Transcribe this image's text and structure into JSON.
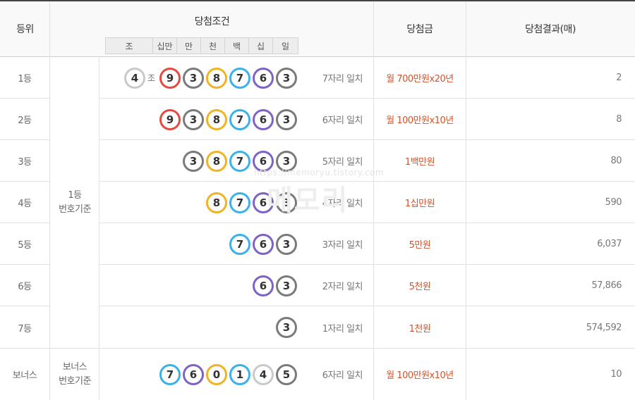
{
  "header": {
    "rank": "등위",
    "condition": "당첨조건",
    "prize": "당첨금",
    "result": "당첨결과(매)",
    "digits": [
      "조",
      "십만",
      "만",
      "천",
      "백",
      "십",
      "일"
    ]
  },
  "rows": [
    {
      "rank": "1등",
      "jo": "4",
      "jo_label": "조",
      "balls": [
        "9",
        "3",
        "8",
        "7",
        "6",
        "3"
      ],
      "match": "7자리 일치",
      "prize": "월 700만원x20년",
      "count": "2"
    },
    {
      "rank": "2등",
      "balls": [
        "9",
        "3",
        "8",
        "7",
        "6",
        "3"
      ],
      "match": "6자리 일치",
      "prize": "월 100만원x10년",
      "count": "8"
    },
    {
      "rank": "3등",
      "balls": [
        "3",
        "8",
        "7",
        "6",
        "3"
      ],
      "match": "5자리 일치",
      "prize": "1백만원",
      "count": "80"
    },
    {
      "rank": "4등",
      "balls": [
        "8",
        "7",
        "6",
        "3"
      ],
      "match": "4자리 일치",
      "prize": "1십만원",
      "count": "590"
    },
    {
      "rank": "5등",
      "balls": [
        "7",
        "6",
        "3"
      ],
      "match": "3자리 일치",
      "prize": "5만원",
      "count": "6,037"
    },
    {
      "rank": "6등",
      "balls": [
        "6",
        "3"
      ],
      "match": "2자리 일치",
      "prize": "5천원",
      "count": "57,866"
    },
    {
      "rank": "7등",
      "balls": [
        "3"
      ],
      "match": "1자리 일치",
      "prize": "1천원",
      "count": "574,592"
    },
    {
      "rank": "보너스",
      "balls": [
        "7",
        "6",
        "0",
        "1",
        "4",
        "5"
      ],
      "match": "6자리 일치",
      "prize": "월 100만원x10년",
      "count": "10"
    }
  ],
  "basis": {
    "main_line1": "1등",
    "main_line2": "번호기준",
    "bonus_line1": "보너스",
    "bonus_line2": "번호기준"
  },
  "ball_colors": {
    "0": "c-yellow",
    "1": "c-blue",
    "2": "c-gray",
    "3": "c-gray",
    "4": "c-white",
    "5": "c-gray",
    "6": "c-purple",
    "7": "c-blue",
    "8": "c-yellow",
    "9": "c-red"
  },
  "jo_ball_color": "c-white",
  "watermark": "https://memoryu.tistory.com",
  "watermark_logo": "메모리"
}
